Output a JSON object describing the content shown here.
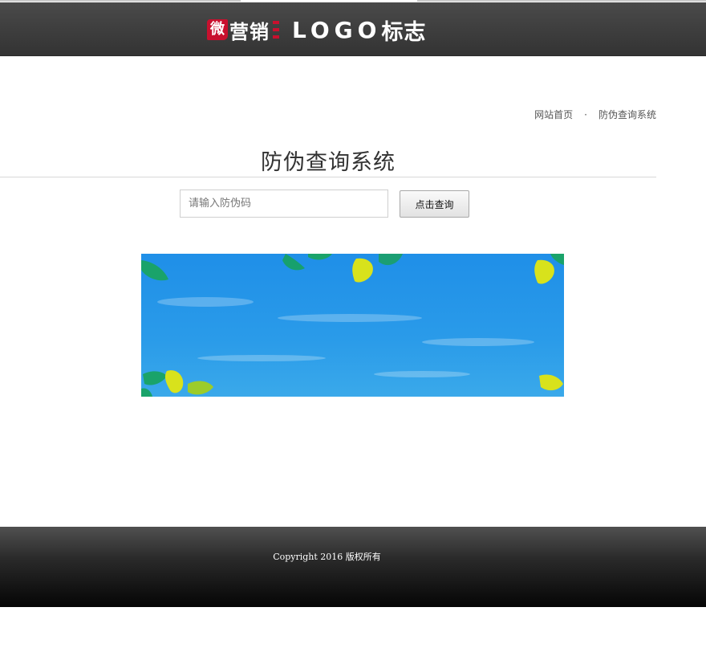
{
  "header": {
    "logo": {
      "badge_text": "微",
      "brand_cn": "营销",
      "brand_en": "LOGO",
      "brand_cn2": "标志"
    }
  },
  "breadcrumb": {
    "home": "网站首页",
    "separator": "·",
    "current": "防伪查询系统"
  },
  "page": {
    "title": "防伪查询系统"
  },
  "search": {
    "placeholder": "请输入防伪码",
    "value": "",
    "button_label": "点击查询"
  },
  "footer": {
    "copyright": "Copyright 2016 版权所有"
  },
  "colors": {
    "header_bg": "#3a3a3a",
    "brand_red": "#c8102e",
    "banner_blue": "#2596e8",
    "leaf_green": "#1aa36a",
    "leaf_yellow": "#d8e21c"
  }
}
